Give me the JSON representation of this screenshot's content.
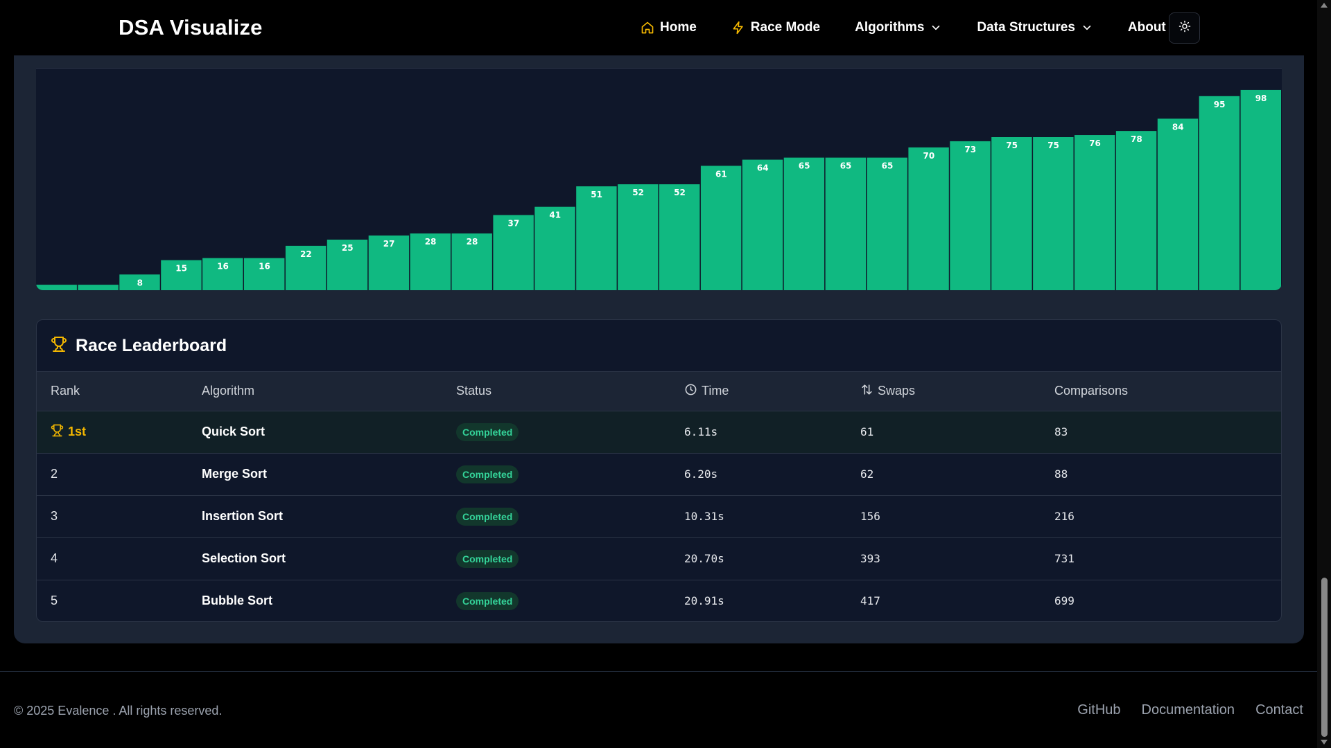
{
  "brand": "DSA Visualize",
  "nav": {
    "home": "Home",
    "race_mode": "Race Mode",
    "algorithms": "Algorithms",
    "data_structures": "Data Structures",
    "about": "About"
  },
  "colors": {
    "bar": "#10b981",
    "accent_gold": "#f5b800",
    "completed_text": "#34d399"
  },
  "chart_data": {
    "type": "bar",
    "values": [
      3,
      3,
      8,
      15,
      16,
      16,
      22,
      25,
      27,
      28,
      28,
      37,
      41,
      51,
      52,
      52,
      61,
      64,
      65,
      65,
      65,
      70,
      73,
      75,
      75,
      76,
      78,
      84,
      95,
      98
    ],
    "labels": [
      "",
      "",
      "8",
      "15",
      "16",
      "16",
      "22",
      "25",
      "27",
      "28",
      "28",
      "37",
      "41",
      "51",
      "52",
      "52",
      "61",
      "64",
      "65",
      "65",
      "65",
      "70",
      "73",
      "75",
      "75",
      "76",
      "78",
      "84",
      "95",
      "98"
    ],
    "ylim": [
      0,
      100
    ]
  },
  "leaderboard": {
    "title": "Race Leaderboard",
    "headers": {
      "rank": "Rank",
      "algorithm": "Algorithm",
      "status": "Status",
      "time": "Time",
      "swaps": "Swaps",
      "comparisons": "Comparisons"
    },
    "rows": [
      {
        "rank": "1st",
        "algorithm": "Quick Sort",
        "status": "Completed",
        "time": "6.11s",
        "swaps": "61",
        "comparisons": "83"
      },
      {
        "rank": "2",
        "algorithm": "Merge Sort",
        "status": "Completed",
        "time": "6.20s",
        "swaps": "62",
        "comparisons": "88"
      },
      {
        "rank": "3",
        "algorithm": "Insertion Sort",
        "status": "Completed",
        "time": "10.31s",
        "swaps": "156",
        "comparisons": "216"
      },
      {
        "rank": "4",
        "algorithm": "Selection Sort",
        "status": "Completed",
        "time": "20.70s",
        "swaps": "393",
        "comparisons": "731"
      },
      {
        "rank": "5",
        "algorithm": "Bubble Sort",
        "status": "Completed",
        "time": "20.91s",
        "swaps": "417",
        "comparisons": "699"
      }
    ]
  },
  "footer": {
    "copyright": "© 2025 Evalence . All rights reserved.",
    "links": {
      "github": "GitHub",
      "documentation": "Documentation",
      "contact": "Contact"
    }
  }
}
